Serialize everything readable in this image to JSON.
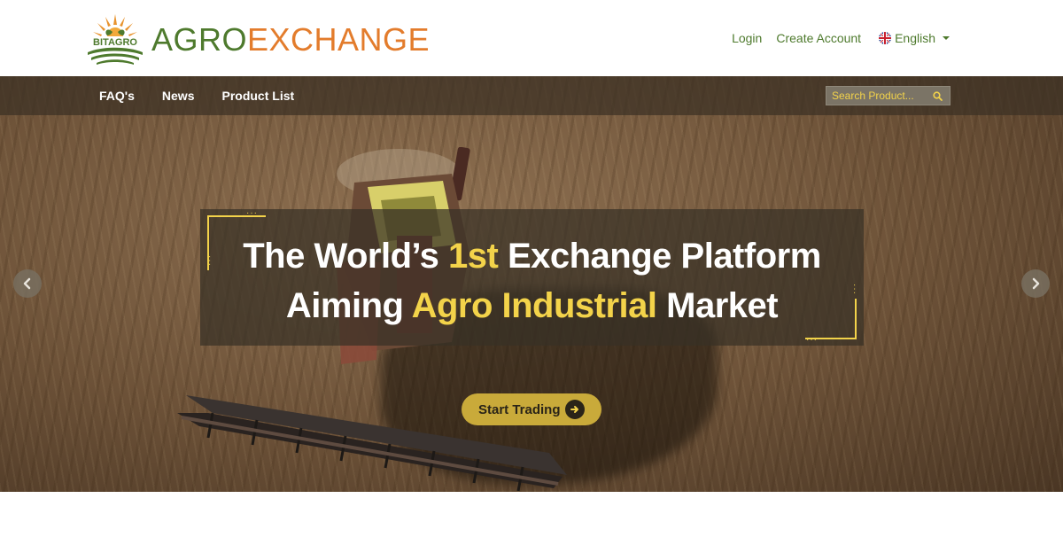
{
  "brand": {
    "logo_mark_text": "BITAGRO",
    "name_part1": "AGRO",
    "name_part2": "EXCHANGE",
    "colors": {
      "green": "#4e7a2d",
      "orange": "#e37c2c",
      "accent_yellow": "#f3d34a"
    }
  },
  "header": {
    "login_label": "Login",
    "create_account_label": "Create Account",
    "language": {
      "selected": "English",
      "icon": "uk-flag-icon"
    }
  },
  "nav": {
    "items": [
      {
        "label": "FAQ's"
      },
      {
        "label": "News"
      },
      {
        "label": "Product List"
      }
    ],
    "search": {
      "placeholder": "Search Product...",
      "icon": "search-icon"
    }
  },
  "hero": {
    "line1": {
      "part1": "The World’s ",
      "highlight": "1st",
      "part2": " Exchange Platform"
    },
    "line2": {
      "part1": "Aiming ",
      "highlight": "Agro Industrial",
      "part2": " Market"
    },
    "cta_label": "Start Trading",
    "cta_icon": "arrow-circle-right-icon",
    "prev_icon": "chevron-left-icon",
    "next_icon": "chevron-right-icon"
  }
}
